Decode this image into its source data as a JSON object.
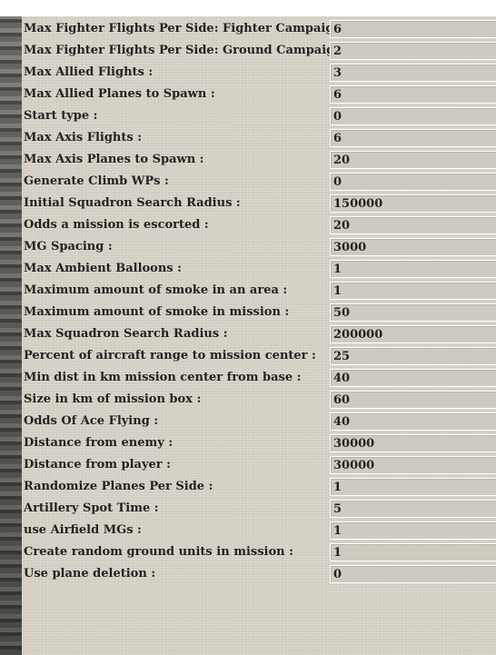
{
  "settings": [
    {
      "label": "Max Fighter Flights Per Side: Fighter Campaigns :",
      "value": "6"
    },
    {
      "label": "Max Fighter Flights Per Side: Ground Campaigns :",
      "value": "2"
    },
    {
      "label": "Max Allied Flights :",
      "value": "3"
    },
    {
      "label": "Max Allied Planes to Spawn :",
      "value": "6"
    },
    {
      "label": "Start type :",
      "value": "0"
    },
    {
      "label": "Max Axis Flights :",
      "value": "6"
    },
    {
      "label": "Max Axis Planes to Spawn :",
      "value": "20"
    },
    {
      "label": "Generate Climb WPs :",
      "value": "0"
    },
    {
      "label": "Initial Squadron Search Radius :",
      "value": "150000"
    },
    {
      "label": "Odds a mission is escorted :",
      "value": "20"
    },
    {
      "label": "MG Spacing :",
      "value": "3000"
    },
    {
      "label": "Max Ambient Balloons :",
      "value": "1"
    },
    {
      "label": "Maximum amount of smoke in an area :",
      "value": "1"
    },
    {
      "label": "Maximum amount of smoke in mission :",
      "value": "50"
    },
    {
      "label": "Max Squadron Search Radius :",
      "value": "200000"
    },
    {
      "label": "Percent of aircraft range to mission center :",
      "value": "25"
    },
    {
      "label": "Min dist in km mission center from base :",
      "value": "40"
    },
    {
      "label": "Size in km of mission box :",
      "value": "60"
    },
    {
      "label": "Odds Of Ace Flying :",
      "value": "40"
    },
    {
      "label": "Distance from enemy :",
      "value": "30000"
    },
    {
      "label": "Distance from player :",
      "value": "30000"
    },
    {
      "label": "Randomize Planes Per Side :",
      "value": "1"
    },
    {
      "label": "Artillery Spot Time :",
      "value": "5"
    },
    {
      "label": "use Airfield MGs :",
      "value": "1"
    },
    {
      "label": "Create random ground units in mission :",
      "value": "1"
    },
    {
      "label": "Use plane deletion :",
      "value": "0"
    }
  ]
}
